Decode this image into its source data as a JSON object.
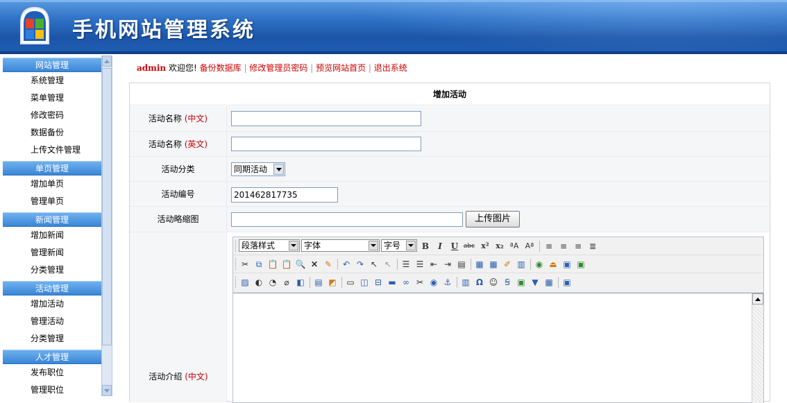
{
  "header": {
    "title": "手机网站管理系统"
  },
  "sidebar": {
    "sections": [
      {
        "title": "网站管理",
        "items": [
          "系统管理",
          "菜单管理",
          "修改密码",
          "数据备份",
          "上传文件管理"
        ]
      },
      {
        "title": "单页管理",
        "items": [
          "增加单页",
          "管理单页"
        ]
      },
      {
        "title": "新闻管理",
        "items": [
          "增加新闻",
          "管理新闻",
          "分类管理"
        ]
      },
      {
        "title": "活动管理",
        "items": [
          "增加活动",
          "管理活动",
          "分类管理"
        ]
      },
      {
        "title": "人才管理",
        "items": [
          "发布职位",
          "管理职位"
        ]
      }
    ]
  },
  "topbar": {
    "user": "admin",
    "welcome": "欢迎您!",
    "links": [
      "备份数据库",
      "修改管理员密码",
      "预览网站首页",
      "退出系统"
    ],
    "separator": "|"
  },
  "form": {
    "title": "增加活动",
    "name_cn_label": "活动名称",
    "name_cn_suffix": "(中文)",
    "name_en_label": "活动名称",
    "name_en_suffix": "(英文)",
    "category_label": "活动分类",
    "category_value": "同期活动",
    "number_label": "活动编号",
    "number_value": "201462817735",
    "thumb_label": "活动略缩图",
    "upload_button": "上传图片",
    "intro_label": "活动介绍",
    "intro_suffix": "(中文)"
  },
  "editor": {
    "paragraph_style": "段落样式",
    "font": "字体",
    "font_size": "字号"
  }
}
